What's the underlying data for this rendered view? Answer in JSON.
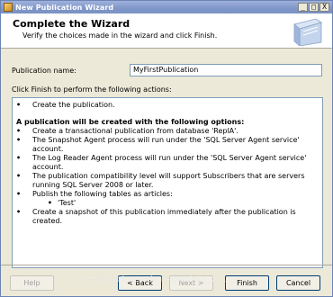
{
  "window": {
    "title": "New Publication Wizard",
    "minimize": "_",
    "maximize": "□",
    "close": "X"
  },
  "header": {
    "title": "Complete the Wizard",
    "subtitle": "Verify the choices made in the wizard and click Finish."
  },
  "form": {
    "publication_label": "Publication name:",
    "publication_value": "MyFirstPublication",
    "instructions": "Click Finish to perform the following actions:"
  },
  "summary": {
    "first_bullet": "Create the publication.",
    "options_heading": "A publication will be created with the following options:",
    "bullets": [
      "Create a transactional publication from database 'ReplA'.",
      "The Snapshot Agent process will run under the 'SQL Server Agent service' account.",
      "The Log Reader Agent process will run under the 'SQL Server Agent service' account.",
      "The publication compatibility level will support Subscribers that are servers running SQL Server 2008 or later.",
      "Publish the following tables as articles:"
    ],
    "article": "'Test'",
    "last_bullet": "Create a snapshot of this publication immediately after the publication is created."
  },
  "buttons": {
    "help": "Help",
    "back": "< Back",
    "next": "Next >",
    "finish": "Finish",
    "cancel": "Cancel"
  },
  "watermark": "https://blog.csdn.net/weixin_43..."
}
